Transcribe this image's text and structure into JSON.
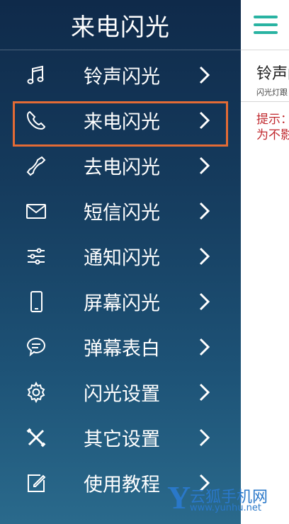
{
  "drawer": {
    "title": "来电闪光",
    "items": [
      {
        "label": "铃声闪光",
        "icon": "music-note-icon"
      },
      {
        "label": "来电闪光",
        "icon": "phone-incoming-icon"
      },
      {
        "label": "去电闪光",
        "icon": "phone-outgoing-icon"
      },
      {
        "label": "短信闪光",
        "icon": "envelope-icon"
      },
      {
        "label": "通知闪光",
        "icon": "sliders-icon"
      },
      {
        "label": "屏幕闪光",
        "icon": "smartphone-icon"
      },
      {
        "label": "弹幕表白",
        "icon": "chat-bubble-icon"
      },
      {
        "label": "闪光设置",
        "icon": "gear-icon"
      },
      {
        "label": "其它设置",
        "icon": "tools-icon"
      },
      {
        "label": "使用教程",
        "icon": "edit-note-icon"
      }
    ],
    "selected_index": 1
  },
  "content": {
    "menu_icon": "hamburger-icon",
    "title": "铃声闪",
    "subtitle": "闪光灯跟",
    "tip_line1": "提示：",
    "tip_line2": "为不影"
  },
  "watermark": {
    "logo_letter": "Y",
    "brand": "云狐手机网",
    "url": "www.yunhu.net"
  },
  "colors": {
    "accent": "#29b3a2",
    "highlight": "#e46b35",
    "tip": "#c0282d",
    "watermark": "#2a78c9"
  }
}
